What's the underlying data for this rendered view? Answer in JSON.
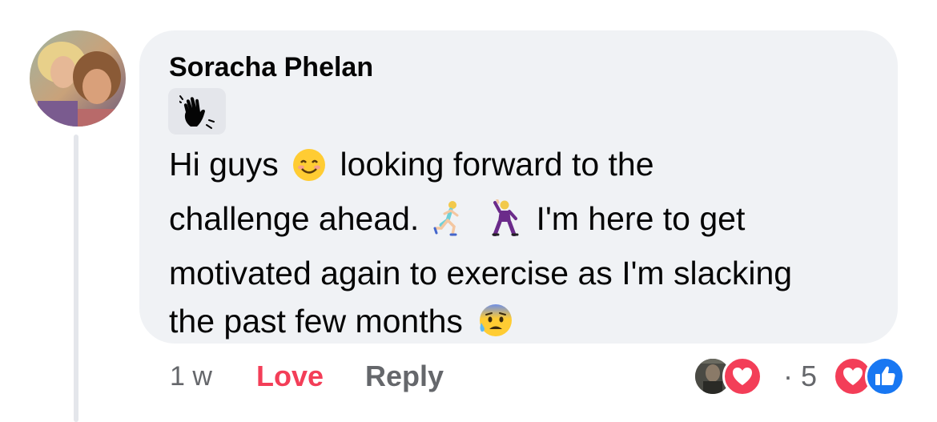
{
  "comment": {
    "author": "Soracha Phelan",
    "badge_icon": "waving-hand-icon",
    "text_lines": [
      {
        "before": "Hi guys",
        "emoji": "smiling-face-emoji",
        "after": "looking forward to the"
      },
      {
        "before": "challenge ahead.",
        "emoji": "running-woman-emoji",
        "emoji2": "dancing-man-emoji",
        "after": "I'm here to get"
      },
      {
        "before": "motivated again to exercise as I'm slacking"
      },
      {
        "before": "the past few months",
        "emoji": "anxious-face-sweat-emoji"
      }
    ]
  },
  "actions": {
    "timestamp": "1 w",
    "love_label": "Love",
    "reply_label": "Reply"
  },
  "reactions": {
    "separator": "·",
    "count": "5",
    "types": [
      "love",
      "like"
    ]
  },
  "colors": {
    "bubble": "#f0f2f5",
    "love": "#f33e58",
    "like": "#1877f2",
    "muted": "#65676b",
    "text": "#050505"
  }
}
